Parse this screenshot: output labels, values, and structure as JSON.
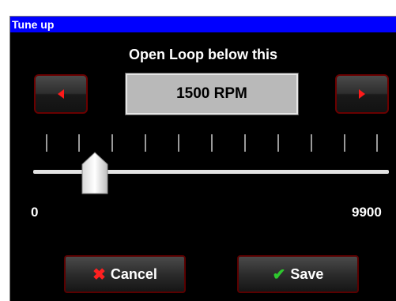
{
  "window": {
    "title": "Tune up"
  },
  "heading": "Open Loop below this",
  "value_display": "1500 RPM",
  "slider": {
    "min_label": "0",
    "max_label": "9900",
    "value": 1500,
    "tick_count": 11
  },
  "buttons": {
    "decrement_icon": "left-arrow-icon",
    "increment_icon": "right-arrow-icon",
    "cancel_label": "Cancel",
    "cancel_icon": "x-icon",
    "save_label": "Save",
    "save_icon": "check-icon"
  },
  "colors": {
    "titlebar": "#0000ff",
    "background": "#000000",
    "arrow": "#ff1a1a",
    "check": "#2ec82e",
    "cancel_x": "#ff2020"
  }
}
